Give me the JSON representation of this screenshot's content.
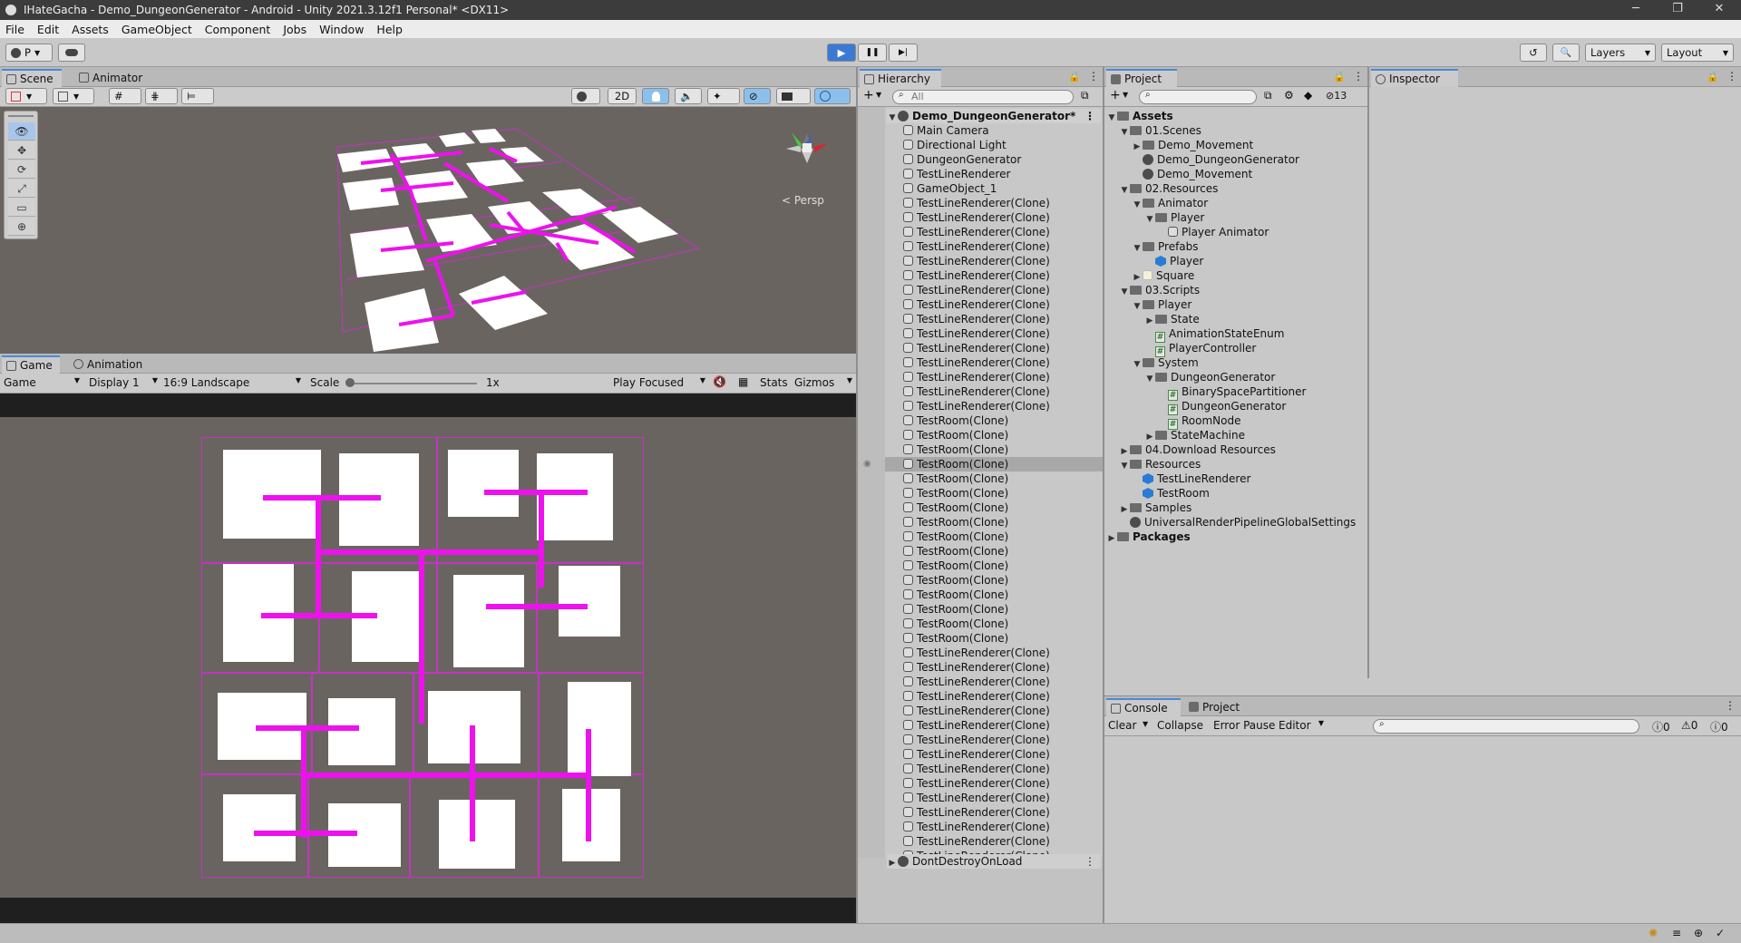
{
  "window": {
    "title": "IHateGacha - Demo_DungeonGenerator - Android - Unity 2021.3.12f1 Personal* <DX11>",
    "minimize": "─",
    "restore": "❐",
    "close": "✕"
  },
  "menu": [
    "File",
    "Edit",
    "Assets",
    "GameObject",
    "Component",
    "Jobs",
    "Window",
    "Help"
  ],
  "toolbar": {
    "account_label": "P",
    "play_icon": "▶",
    "pause_icon": "❚❚",
    "step_icon": "▶|",
    "layers_label": "Layers",
    "layout_label": "Layout",
    "history_icon": "↺",
    "search_icon": "🔍"
  },
  "scene": {
    "tabs": [
      "Scene",
      "Animator"
    ],
    "mode_2d": "2D",
    "persp_label": "Persp",
    "tools": [
      "👁",
      "✥",
      "⟳",
      "⤢",
      "▭",
      "⊕"
    ]
  },
  "game": {
    "tabs": [
      "Game",
      "Animation"
    ],
    "display_mode": "Game",
    "display": "Display 1",
    "aspect": "16:9 Landscape",
    "scale_label": "Scale",
    "scale_value": "1x",
    "play_mode": "Play Focused",
    "stats_label": "Stats",
    "gizmos_label": "Gizmos"
  },
  "hierarchy": {
    "tab": "Hierarchy",
    "search_placeholder": "All",
    "scene_name": "Demo_DungeonGenerator*",
    "items": [
      "Main Camera",
      "Directional Light",
      "DungeonGenerator",
      "TestLineRenderer",
      "GameObject_1",
      "TestLineRenderer(Clone)",
      "TestLineRenderer(Clone)",
      "TestLineRenderer(Clone)",
      "TestLineRenderer(Clone)",
      "TestLineRenderer(Clone)",
      "TestLineRenderer(Clone)",
      "TestLineRenderer(Clone)",
      "TestLineRenderer(Clone)",
      "TestLineRenderer(Clone)",
      "TestLineRenderer(Clone)",
      "TestLineRenderer(Clone)",
      "TestLineRenderer(Clone)",
      "TestLineRenderer(Clone)",
      "TestLineRenderer(Clone)",
      "TestLineRenderer(Clone)",
      "TestRoom(Clone)",
      "TestRoom(Clone)",
      "TestRoom(Clone)",
      "TestRoom(Clone)",
      "TestRoom(Clone)",
      "TestRoom(Clone)",
      "TestRoom(Clone)",
      "TestRoom(Clone)",
      "TestRoom(Clone)",
      "TestRoom(Clone)",
      "TestRoom(Clone)",
      "TestRoom(Clone)",
      "TestRoom(Clone)",
      "TestRoom(Clone)",
      "TestRoom(Clone)",
      "TestRoom(Clone)",
      "TestLineRenderer(Clone)",
      "TestLineRenderer(Clone)",
      "TestLineRenderer(Clone)",
      "TestLineRenderer(Clone)",
      "TestLineRenderer(Clone)",
      "TestLineRenderer(Clone)",
      "TestLineRenderer(Clone)",
      "TestLineRenderer(Clone)",
      "TestLineRenderer(Clone)",
      "TestLineRenderer(Clone)",
      "TestLineRenderer(Clone)",
      "TestLineRenderer(Clone)",
      "TestLineRenderer(Clone)",
      "TestLineRenderer(Clone)",
      "TestLineRenderer(Clone)"
    ],
    "selected_index": 23,
    "footer_scene": "DontDestroyOnLoad"
  },
  "project": {
    "tab": "Project",
    "hidden_count": "13",
    "tree": [
      {
        "label": "Assets",
        "depth": 0,
        "arrow": "▼",
        "icon": "folder",
        "bold": true
      },
      {
        "label": "01.Scenes",
        "depth": 1,
        "arrow": "▼",
        "icon": "folder"
      },
      {
        "label": "Demo_Movement",
        "depth": 2,
        "arrow": "▶",
        "icon": "folder"
      },
      {
        "label": "Demo_DungeonGenerator",
        "depth": 2,
        "arrow": "",
        "icon": "scene"
      },
      {
        "label": "Demo_Movement",
        "depth": 2,
        "arrow": "",
        "icon": "scene"
      },
      {
        "label": "02.Resources",
        "depth": 1,
        "arrow": "▼",
        "icon": "folder"
      },
      {
        "label": "Animator",
        "depth": 2,
        "arrow": "▼",
        "icon": "folder"
      },
      {
        "label": "Player",
        "depth": 3,
        "arrow": "▼",
        "icon": "folder"
      },
      {
        "label": "Player Animator",
        "depth": 4,
        "arrow": "",
        "icon": "anim"
      },
      {
        "label": "Prefabs",
        "depth": 2,
        "arrow": "▼",
        "icon": "folder"
      },
      {
        "label": "Player",
        "depth": 3,
        "arrow": "",
        "icon": "prefab"
      },
      {
        "label": "Square",
        "depth": 2,
        "arrow": "▶",
        "icon": "sprite"
      },
      {
        "label": "03.Scripts",
        "depth": 1,
        "arrow": "▼",
        "icon": "folder"
      },
      {
        "label": "Player",
        "depth": 2,
        "arrow": "▼",
        "icon": "folder"
      },
      {
        "label": "State",
        "depth": 3,
        "arrow": "▶",
        "icon": "folder"
      },
      {
        "label": "AnimationStateEnum",
        "depth": 3,
        "arrow": "",
        "icon": "script"
      },
      {
        "label": "PlayerController",
        "depth": 3,
        "arrow": "",
        "icon": "script"
      },
      {
        "label": "System",
        "depth": 2,
        "arrow": "▼",
        "icon": "folder"
      },
      {
        "label": "DungeonGenerator",
        "depth": 3,
        "arrow": "▼",
        "icon": "folder"
      },
      {
        "label": "BinarySpacePartitioner",
        "depth": 4,
        "arrow": "",
        "icon": "script"
      },
      {
        "label": "DungeonGenerator",
        "depth": 4,
        "arrow": "",
        "icon": "script"
      },
      {
        "label": "RoomNode",
        "depth": 4,
        "arrow": "",
        "icon": "script"
      },
      {
        "label": "StateMachine",
        "depth": 3,
        "arrow": "▶",
        "icon": "folder"
      },
      {
        "label": "04.Download Resources",
        "depth": 1,
        "arrow": "▶",
        "icon": "folder"
      },
      {
        "label": "Resources",
        "depth": 1,
        "arrow": "▼",
        "icon": "folder"
      },
      {
        "label": "TestLineRenderer",
        "depth": 2,
        "arrow": "",
        "icon": "prefab"
      },
      {
        "label": "TestRoom",
        "depth": 2,
        "arrow": "",
        "icon": "prefab"
      },
      {
        "label": "Samples",
        "depth": 1,
        "arrow": "▶",
        "icon": "folder"
      },
      {
        "label": "UniversalRenderPipelineGlobalSettings",
        "depth": 1,
        "arrow": "",
        "icon": "settings"
      },
      {
        "label": "Packages",
        "depth": 0,
        "arrow": "▶",
        "icon": "folder",
        "bold": true
      }
    ]
  },
  "inspector": {
    "tab": "Inspector"
  },
  "console": {
    "tabs": [
      "Console",
      "Project"
    ],
    "clear": "Clear",
    "collapse": "Collapse",
    "error_pause": "Error Pause",
    "editor": "Editor",
    "log_count": "0",
    "warn_count": "0",
    "error_count": "0"
  },
  "colors": {
    "corridor": "#ee11ee",
    "cell_border": "#c433c4",
    "game_bg": "#6a6460",
    "scene_bg": "#6a6460",
    "accent": "#4a8ad8"
  }
}
